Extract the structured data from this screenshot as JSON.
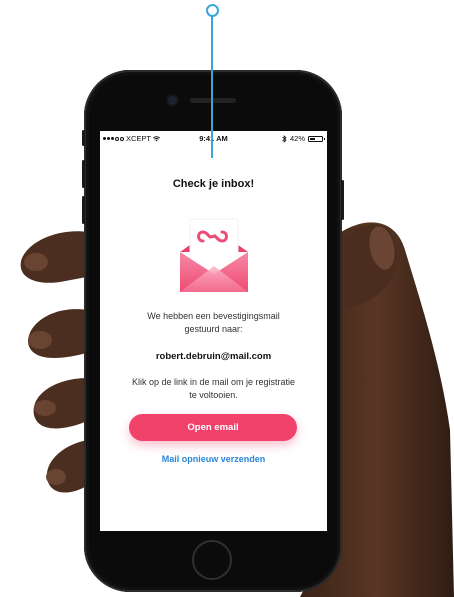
{
  "statusbar": {
    "carrier": "XCEPT",
    "time": "9:41 AM",
    "battery_percent": "42%",
    "battery_level": 0.42,
    "signal_dots_filled": 3,
    "icons": [
      "wifi-icon",
      "bluetooth-icon",
      "battery-icon"
    ]
  },
  "screen": {
    "title": "Check je inbox!",
    "message_line_1": "We hebben een bevestigingsmail",
    "message_line_2": "gestuurd naar:",
    "email": "robert.debruin@mail.com",
    "instruction_line_1": "Klik op de link in de mail om je registratie",
    "instruction_line_2": "te voltooien.",
    "open_button": "Open email",
    "resend_link": "Mail opnieuw verzenden"
  },
  "colors": {
    "accent": "#f0426b",
    "link": "#2b86d9",
    "annotation": "#3aa6d8"
  }
}
